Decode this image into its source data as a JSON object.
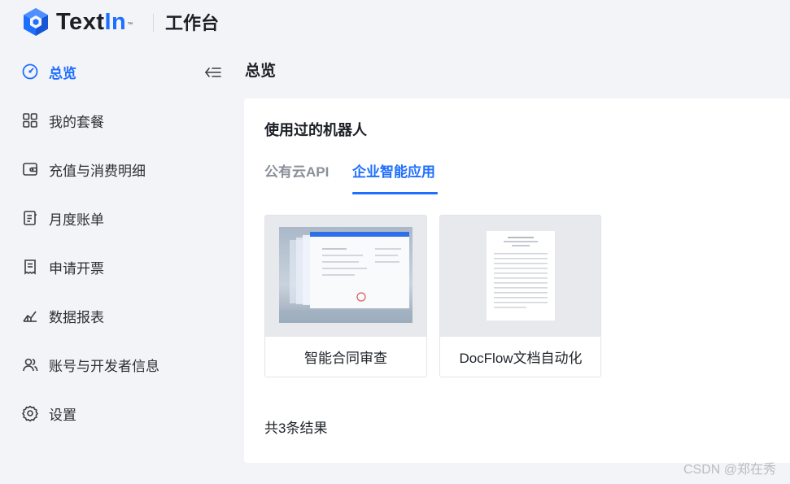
{
  "header": {
    "brand_text": "Text",
    "brand_in": "In",
    "brand_tm": "™",
    "workbench": "工作台"
  },
  "sidebar": {
    "items": [
      {
        "label": "总览",
        "icon": "dashboard-icon",
        "active": true
      },
      {
        "label": "我的套餐",
        "icon": "grid-icon",
        "active": false
      },
      {
        "label": "充值与消费明细",
        "icon": "wallet-icon",
        "active": false
      },
      {
        "label": "月度账单",
        "icon": "bill-icon",
        "active": false
      },
      {
        "label": "申请开票",
        "icon": "receipt-icon",
        "active": false
      },
      {
        "label": "数据报表",
        "icon": "chart-icon",
        "active": false
      },
      {
        "label": "账号与开发者信息",
        "icon": "users-icon",
        "active": false
      },
      {
        "label": "设置",
        "icon": "gear-icon",
        "active": false
      }
    ]
  },
  "main": {
    "title": "总览",
    "card_title": "使用过的机器人",
    "tabs": [
      {
        "label": "公有云API",
        "active": false
      },
      {
        "label": "企业智能应用",
        "active": true
      }
    ],
    "robots": [
      {
        "label": "智能合同审查"
      },
      {
        "label": "DocFlow文档自动化"
      }
    ],
    "result_count": "共3条结果"
  },
  "watermark": "CSDN @郑在秀",
  "colors": {
    "accent": "#1f6fff",
    "background": "#f3f4f7",
    "card": "#ffffff"
  }
}
